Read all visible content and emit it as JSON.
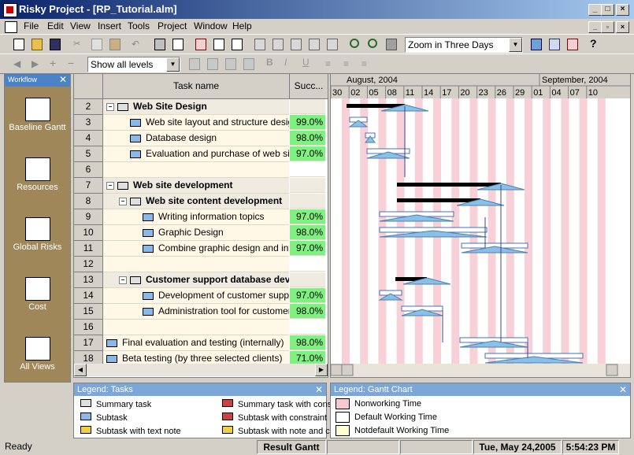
{
  "window": {
    "title": "Risky Project - [RP_Tutorial.alm]"
  },
  "menu": [
    "File",
    "Edit",
    "View",
    "Insert",
    "Tools",
    "Project",
    "Window",
    "Help"
  ],
  "toolbar": {
    "zoom_value": "Zoom in Three Days",
    "levels_value": "Show all levels"
  },
  "workflow": {
    "title": "Workflow",
    "items": [
      {
        "label": "Baseline Gantt",
        "icon": "gantt-icon"
      },
      {
        "label": "Resources",
        "icon": "resources-icon"
      },
      {
        "label": "Global Risks",
        "icon": "warning-icon"
      },
      {
        "label": "Cost",
        "icon": "cost-icon"
      },
      {
        "label": "All Views",
        "icon": "views-icon"
      }
    ]
  },
  "grid": {
    "col_task": "Task name",
    "col_success": "Succ...",
    "rows": [
      {
        "num": "2",
        "name": "Web Site Design",
        "success": "",
        "level": 0,
        "type": "summary"
      },
      {
        "num": "3",
        "name": "Web site layout and structure design",
        "success": "99.0%",
        "level": 1,
        "type": "task"
      },
      {
        "num": "4",
        "name": "Database design",
        "success": "98.0%",
        "level": 1,
        "type": "task"
      },
      {
        "num": "5",
        "name": "Evaluation and purchase of web site t",
        "success": "97.0%",
        "level": 1,
        "type": "task"
      },
      {
        "num": "6",
        "name": "",
        "success": "",
        "level": 0,
        "type": "blank"
      },
      {
        "num": "7",
        "name": "Web site development",
        "success": "",
        "level": 0,
        "type": "summary"
      },
      {
        "num": "8",
        "name": "Web site content development",
        "success": "",
        "level": 1,
        "type": "summary"
      },
      {
        "num": "9",
        "name": "Writing information topics",
        "success": "97.0%",
        "level": 2,
        "type": "task"
      },
      {
        "num": "10",
        "name": "Graphic Design",
        "success": "98.0%",
        "level": 2,
        "type": "task"
      },
      {
        "num": "11",
        "name": "Combine graphic design and inforr",
        "success": "97.0%",
        "level": 2,
        "type": "task"
      },
      {
        "num": "12",
        "name": "",
        "success": "",
        "level": 0,
        "type": "blank"
      },
      {
        "num": "13",
        "name": "Customer support database dev",
        "success": "",
        "level": 1,
        "type": "summary"
      },
      {
        "num": "14",
        "name": "Development of customer support",
        "success": "97.0%",
        "level": 2,
        "type": "task"
      },
      {
        "num": "15",
        "name": "Administration tool for customer su",
        "success": "98.0%",
        "level": 2,
        "type": "task"
      },
      {
        "num": "16",
        "name": "",
        "success": "",
        "level": 0,
        "type": "blank"
      },
      {
        "num": "17",
        "name": "Final evaluation and testing (internally)",
        "success": "98.0%",
        "level": 0,
        "type": "task"
      },
      {
        "num": "18",
        "name": "Beta testing (by three selected clients)",
        "success": "71.0%",
        "level": 0,
        "type": "task"
      }
    ]
  },
  "gantt": {
    "months": [
      "August, 2004",
      "September, 2004"
    ],
    "days": [
      "30",
      "02",
      "05",
      "08",
      "11",
      "14",
      "17",
      "20",
      "23",
      "26",
      "29",
      "01",
      "04",
      "07",
      "10"
    ]
  },
  "legend_tasks": {
    "title": "Legend: Tasks",
    "items": [
      "Summary task",
      "Subtask",
      "Subtask with text note",
      "Summary task with cons",
      "Subtask with constraint",
      "Subtask with note and c"
    ]
  },
  "legend_gantt": {
    "title": "Legend: Gantt Chart",
    "items": [
      {
        "label": "Nonworking Time",
        "color": "#f8c8d0"
      },
      {
        "label": "Default Working Time",
        "color": "#ffffff"
      },
      {
        "label": "Notdefault Working Time",
        "color": "#ffffd0"
      }
    ]
  },
  "status": {
    "ready": "Ready",
    "view": "Result Gantt",
    "date": "Tue, May 24,2005",
    "time": "5:54:23 PM"
  }
}
